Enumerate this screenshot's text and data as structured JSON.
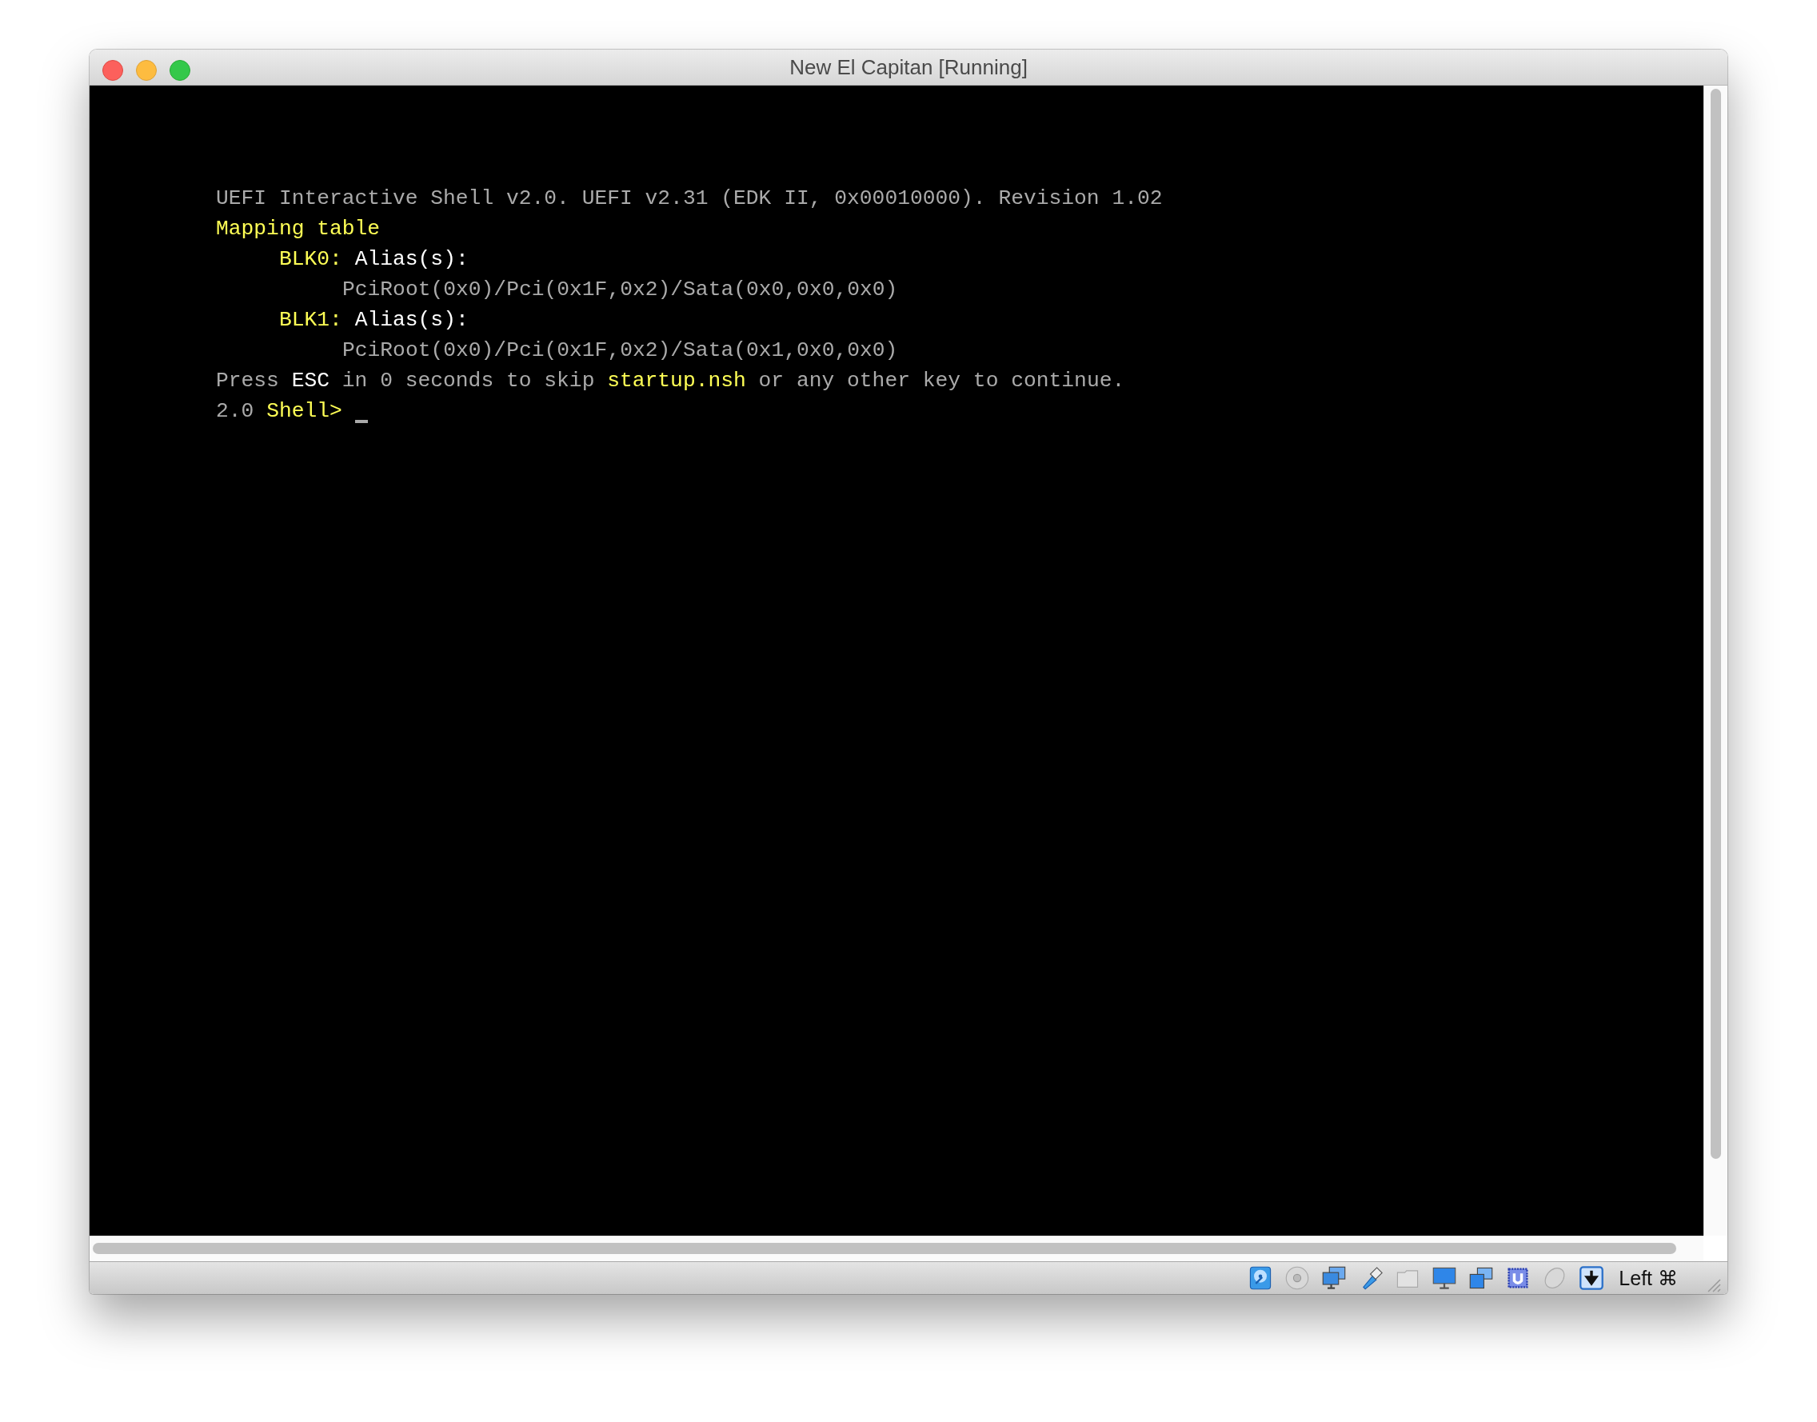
{
  "window": {
    "title": "New El Capitan [Running]"
  },
  "terminal": {
    "lines": [
      {
        "kind": "plain",
        "segments": [
          {
            "text": "UEFI Interactive Shell v2.0. UEFI v2.31 (EDK II, 0x00010000). Revision 1.02",
            "color": "#aaaaaa"
          }
        ]
      },
      {
        "kind": "plain",
        "segments": [
          {
            "text": "Mapping table",
            "color": "#ffff55"
          }
        ]
      },
      {
        "kind": "entry",
        "segments": [
          {
            "text": "BLK0:",
            "color": "#ffff55"
          },
          {
            "text": " Alias(s):",
            "color": "#ffffff"
          }
        ]
      },
      {
        "kind": "path",
        "segments": [
          {
            "text": "PciRoot(0x0)/Pci(0x1F,0x2)/Sata(0x0,0x0,0x0)",
            "color": "#aaaaaa"
          }
        ]
      },
      {
        "kind": "entry",
        "segments": [
          {
            "text": "BLK1:",
            "color": "#ffff55"
          },
          {
            "text": " Alias(s):",
            "color": "#ffffff"
          }
        ]
      },
      {
        "kind": "path",
        "segments": [
          {
            "text": "PciRoot(0x0)/Pci(0x1F,0x2)/Sata(0x1,0x0,0x0)",
            "color": "#aaaaaa"
          }
        ]
      },
      {
        "kind": "plain",
        "segments": [
          {
            "text": "Press ",
            "color": "#aaaaaa"
          },
          {
            "text": "ESC",
            "color": "#ffffff"
          },
          {
            "text": " in 0 seconds to skip ",
            "color": "#aaaaaa"
          },
          {
            "text": "startup.nsh",
            "color": "#ffff55"
          },
          {
            "text": " or any other key to continue.",
            "color": "#aaaaaa"
          }
        ]
      },
      {
        "kind": "prompt",
        "segments": [
          {
            "text": "2.0 ",
            "color": "#aaaaaa"
          },
          {
            "text": "Shell>",
            "color": "#ffff55"
          }
        ]
      }
    ]
  },
  "status_bar": {
    "host_key": "Left ⌘"
  }
}
